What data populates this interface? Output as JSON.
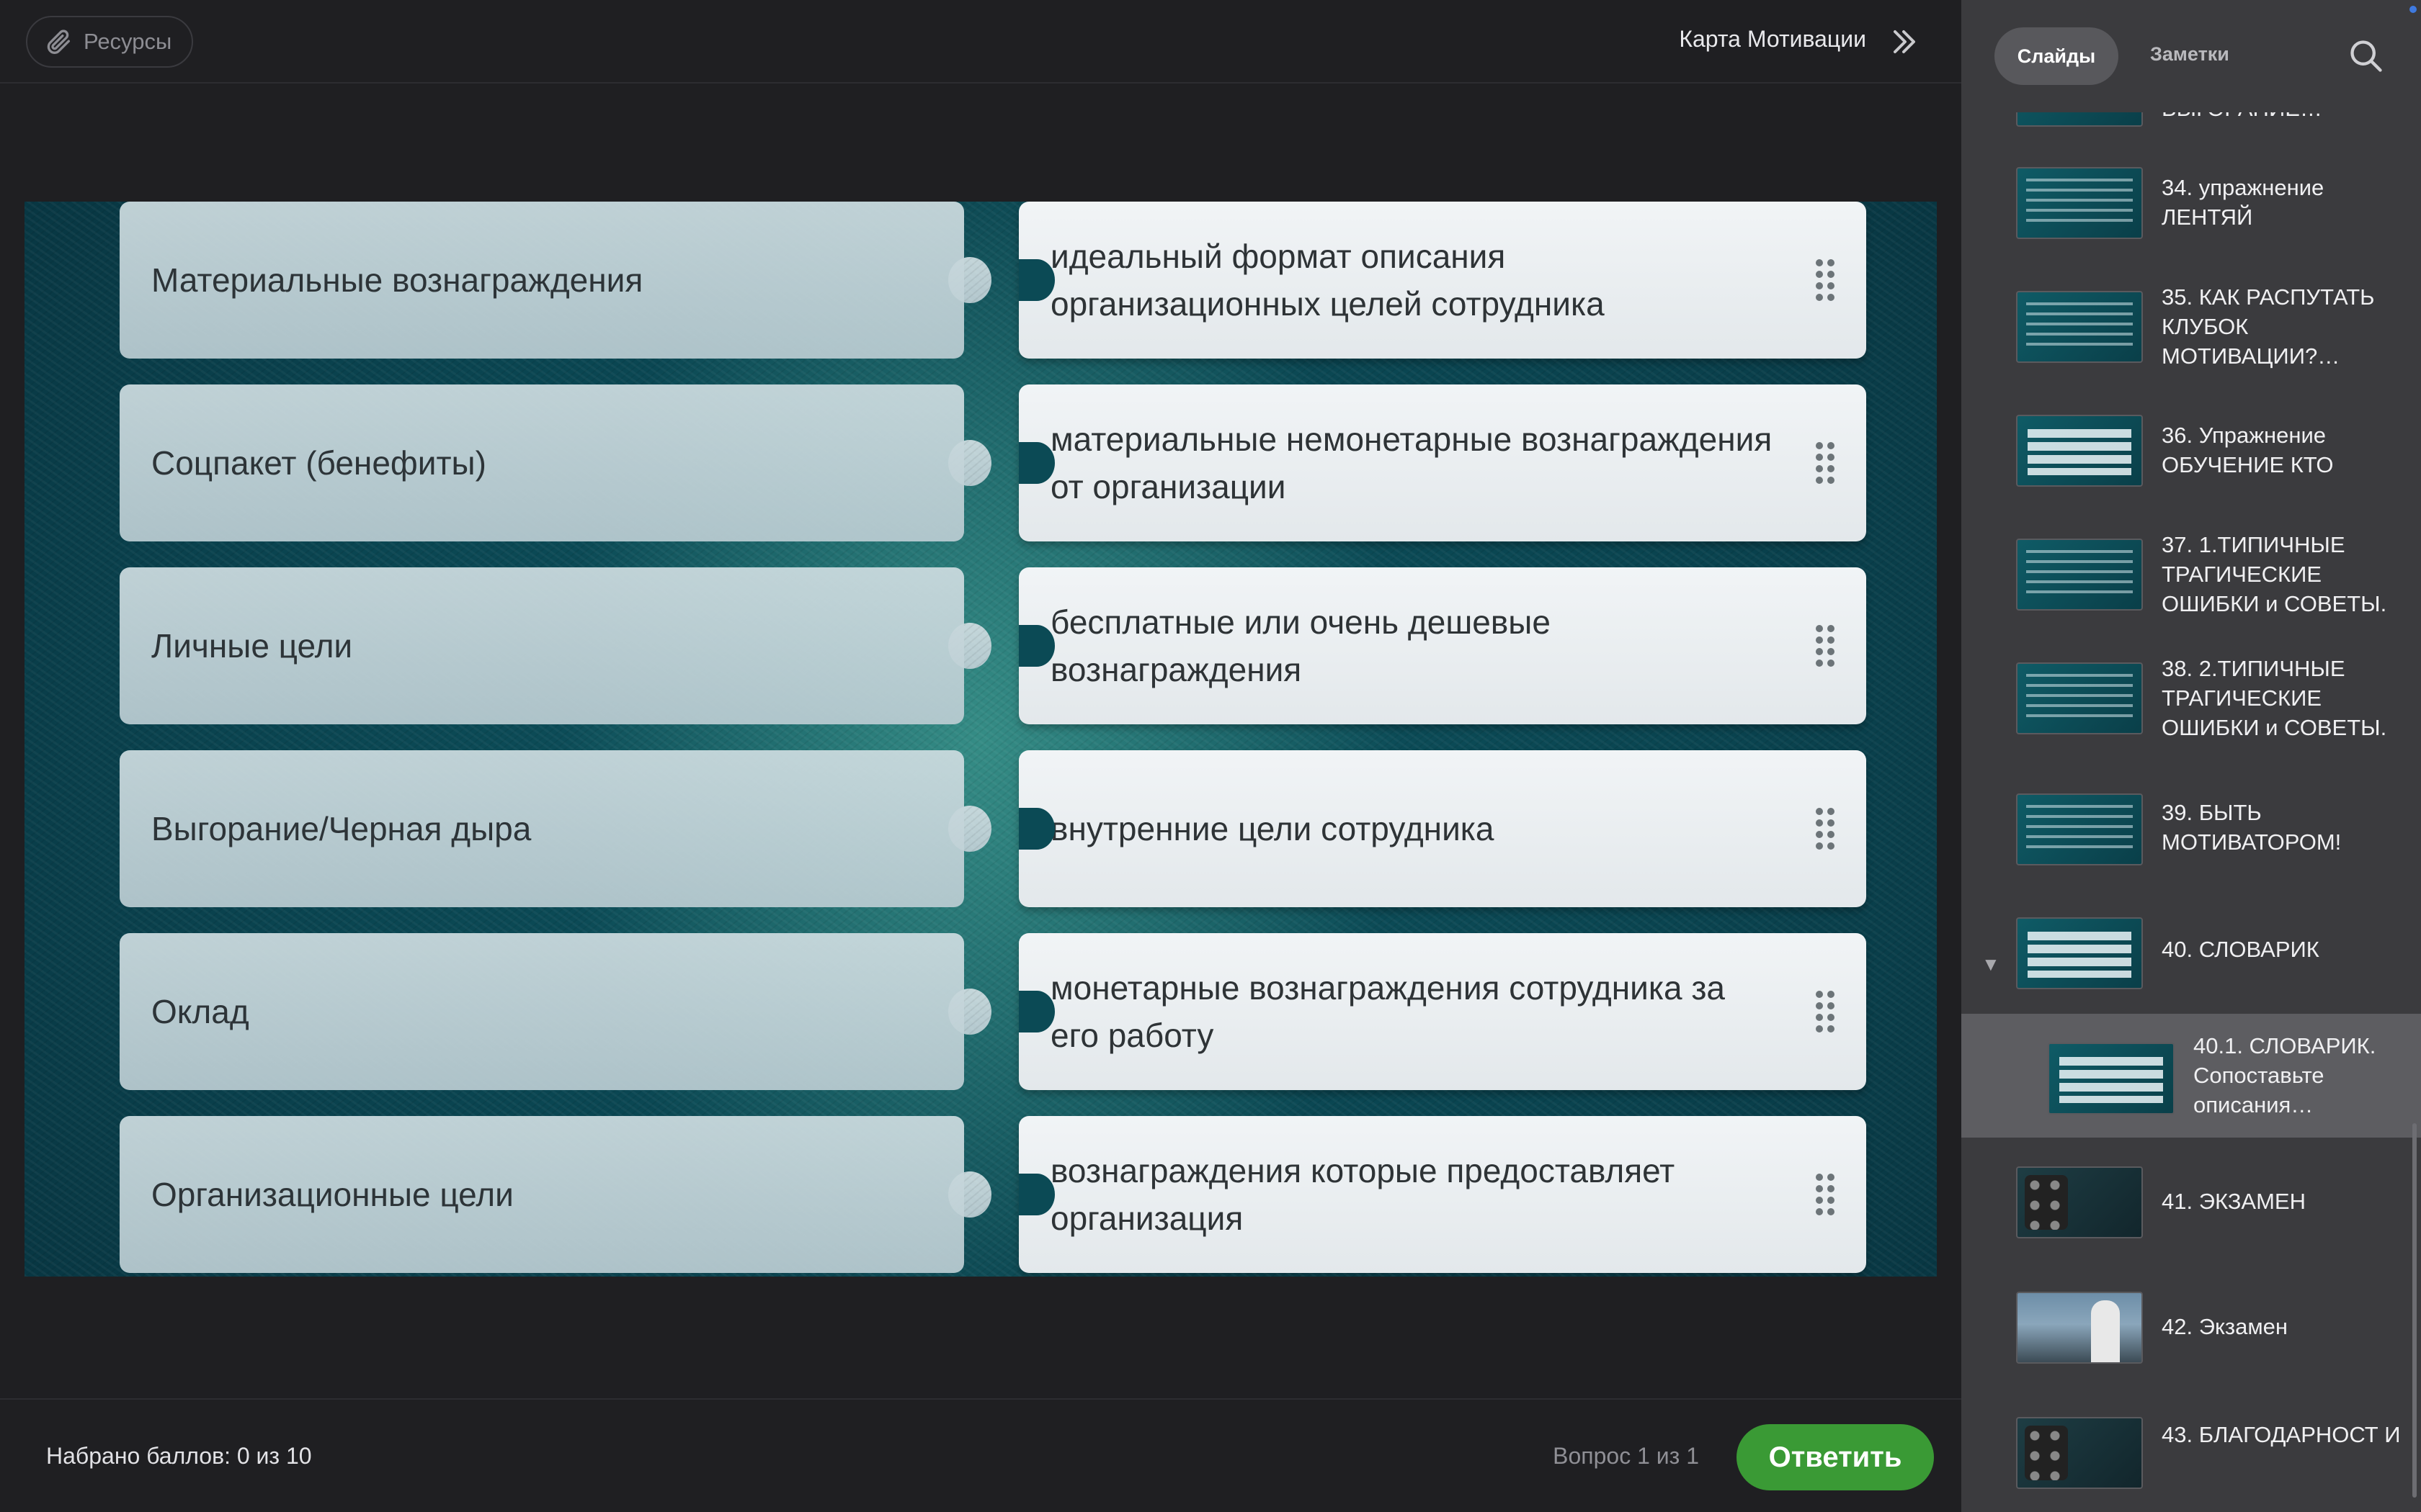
{
  "header": {
    "resources_label": "Ресурсы",
    "course_title": "Карта Мотивации"
  },
  "quiz": {
    "left_items": [
      "Материальные вознаграждения",
      "Соцпакет (бенефиты)",
      "Личные цели",
      "Выгорание/Черная дыра",
      "Оклад",
      "Организационные цели"
    ],
    "right_items": [
      "идеальный формат описания организационных целей сотрудника",
      "материальные немонетарные вознаграждения от организации",
      "бесплатные или очень дешевые вознаграждения",
      "внутренние цели сотрудника",
      "монетарные вознаграждения сотрудника за его работу",
      "вознаграждения которые предоставляет организация"
    ]
  },
  "footer": {
    "score_text": "Набрано баллов: 0 из 10",
    "question_counter": "Вопрос 1 из 1",
    "submit_label": "Ответить"
  },
  "sidebar": {
    "tabs": [
      "Слайды",
      "Заметки"
    ],
    "active_tab": "Слайды",
    "items": [
      {
        "label": "ВЫГОРАНИЕ…",
        "thumb": "text"
      },
      {
        "label": "34. упражнение ЛЕНТЯЙ",
        "thumb": "text"
      },
      {
        "label": "35. КАК РАСПУТАТЬ КЛУБОК МОТИВАЦИИ?…",
        "thumb": "text"
      },
      {
        "label": "36. Упражнение ОБУЧЕНИЕ КТО",
        "thumb": "table"
      },
      {
        "label": "37. 1.ТИПИЧНЫЕ ТРАГИЧЕСКИЕ ОШИБКИ и СОВЕТЫ.",
        "thumb": "text"
      },
      {
        "label": "38. 2.ТИПИЧНЫЕ ТРАГИЧЕСКИЕ ОШИБКИ и СОВЕТЫ.",
        "thumb": "text"
      },
      {
        "label": "39. БЫТЬ МОТИВАТОРОМ!",
        "thumb": "text"
      },
      {
        "label": "40. СЛОВАРИК",
        "thumb": "table",
        "expanded": true
      },
      {
        "label": "40.1. СЛОВАРИК. Сопоставьте описания…",
        "thumb": "table",
        "active": true
      },
      {
        "label": "41. ЭКЗАМЕН",
        "thumb": "dark"
      },
      {
        "label": "42. Экзамен",
        "thumb": "photo"
      },
      {
        "label": "43. БЛАГОДАРНОСТ И",
        "thumb": "dark"
      }
    ]
  },
  "colors": {
    "submit": "#3a9a35",
    "slide_bg": "#0b4a55",
    "sidebar_bg": "#3b3b3e",
    "active_item_bg": "#5d5d61"
  }
}
